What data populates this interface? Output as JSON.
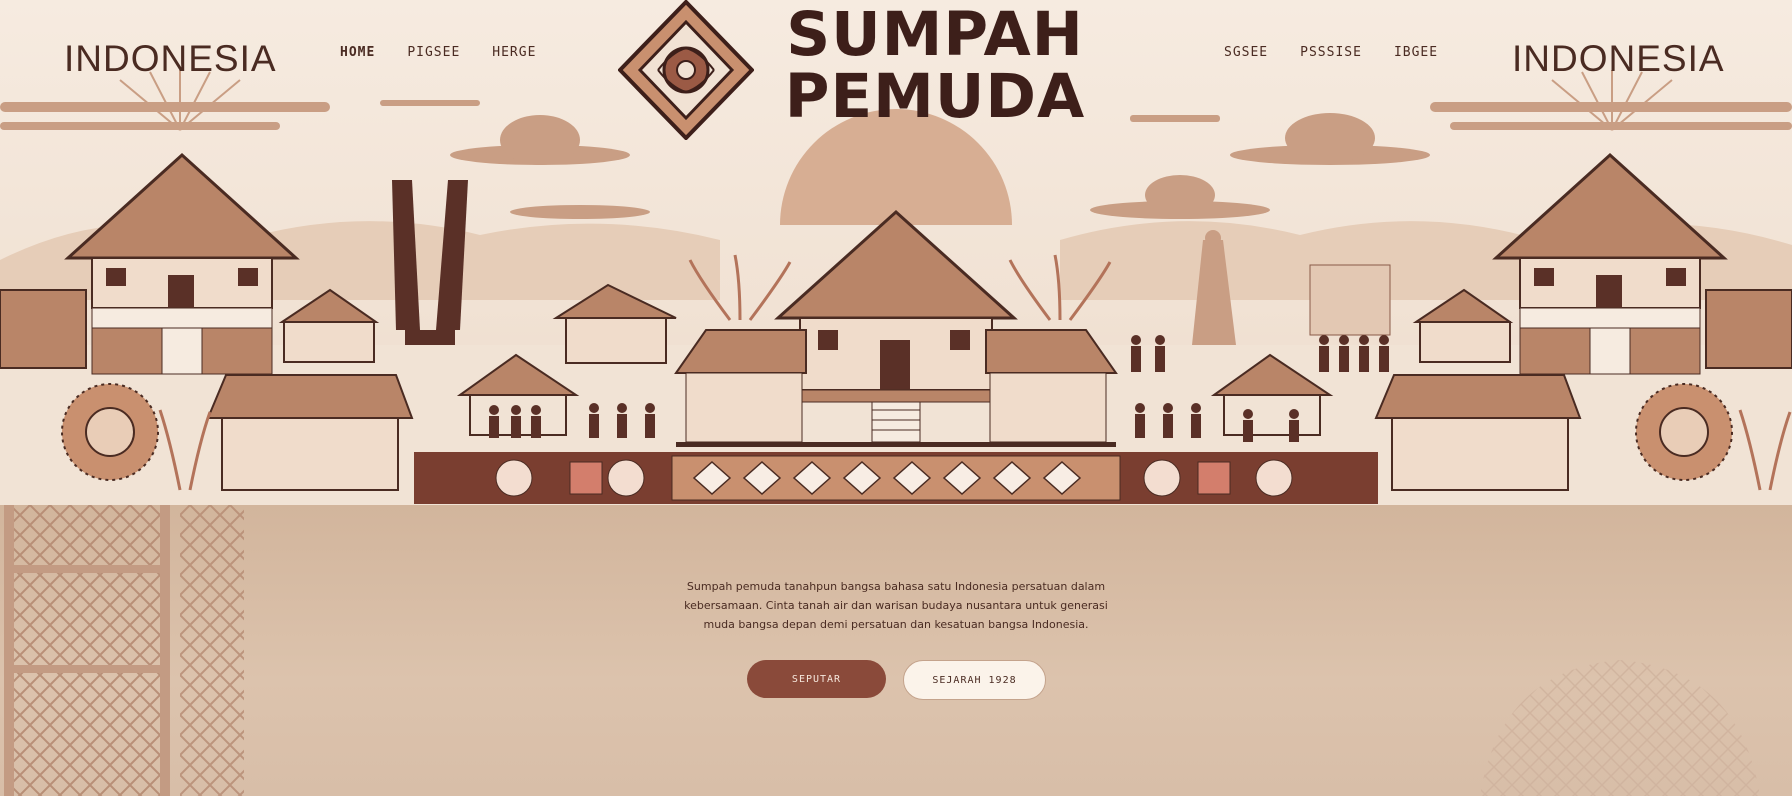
{
  "header": {
    "brand_left": "INDONESIA",
    "brand_right": "INDONESIA",
    "title_line1": "SUMPAH",
    "title_line2": "PEMUDA",
    "nav_left": [
      {
        "label": "HOME",
        "active": true
      },
      {
        "label": "PIGSEE"
      },
      {
        "label": "HERGE"
      }
    ],
    "nav_right": [
      {
        "label": "SGSEE"
      },
      {
        "label": "PSSSISE"
      },
      {
        "label": "IBGEE"
      }
    ]
  },
  "hero": {
    "description": "Sumpah pemuda tanahpun bangsa bahasa satu Indonesia persatuan dalam kebersamaan. Cinta tanah air dan warisan budaya nusantara untuk generasi muda bangsa depan demi persatuan dan kesatuan bangsa Indonesia."
  },
  "actions": {
    "primary_label": "SEPUTAR",
    "secondary_label": "SEJARAH 1928"
  },
  "colors": {
    "accent": "#8a4a3a",
    "dark": "#3d1f1a",
    "banner_bg": "#f3e6d9",
    "lower_bg": "#d6bba3"
  }
}
